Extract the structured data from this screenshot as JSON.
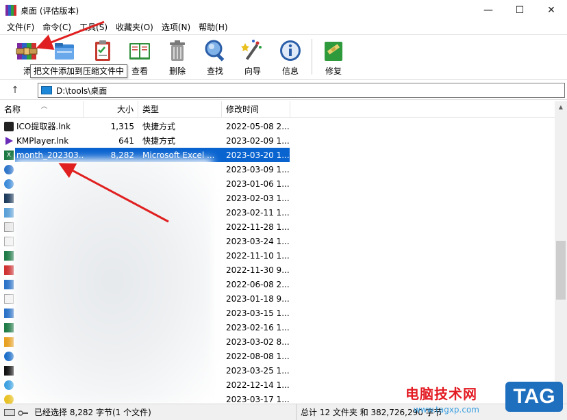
{
  "window": {
    "title": "桌面 (评估版本)",
    "minimize": "—",
    "maximize": "☐",
    "close": "✕"
  },
  "menu": [
    "文件(F)",
    "命令(C)",
    "工具(S)",
    "收藏夹(O)",
    "选项(N)",
    "帮助(H)"
  ],
  "toolbar": {
    "add": "添",
    "view": "查看",
    "delete": "删除",
    "find": "查找",
    "wizard": "向导",
    "info": "信息",
    "repair": "修复"
  },
  "tooltip": "把文件添加到压缩文件中",
  "address": {
    "path": "D:\\tools\\桌面",
    "up": "↑"
  },
  "columns": {
    "name": "名称",
    "size": "大小",
    "type": "类型",
    "modified": "修改时间"
  },
  "files": [
    {
      "name": "ICO提取器.lnk",
      "size": "1,315",
      "type": "快捷方式",
      "modified": "2022-05-08 2..."
    },
    {
      "name": "KMPlayer.lnk",
      "size": "641",
      "type": "快捷方式",
      "modified": "2023-02-09 1..."
    },
    {
      "name": "month_202303...",
      "size": "8,282",
      "type": "Microsoft Excel ...",
      "modified": "2023-03-20 1..."
    },
    {
      "name": "",
      "size": "",
      "type": "",
      "modified": "2023-03-09 1..."
    },
    {
      "name": "",
      "size": "",
      "type": "",
      "modified": "2023-01-06 1..."
    },
    {
      "name": "",
      "size": "",
      "type": "",
      "modified": "2023-02-03 1..."
    },
    {
      "name": "",
      "size": "",
      "type": "",
      "modified": "2023-02-11 1..."
    },
    {
      "name": "",
      "size": "",
      "type": "",
      "modified": "2022-11-28 1..."
    },
    {
      "name": "",
      "size": "",
      "type": "",
      "modified": "2023-03-24 1..."
    },
    {
      "name": "",
      "size": "",
      "type": "",
      "modified": "2022-11-10 1..."
    },
    {
      "name": "",
      "size": "",
      "type": "",
      "modified": "2022-11-30 9..."
    },
    {
      "name": "",
      "size": "",
      "type": "",
      "modified": "2022-06-08 2..."
    },
    {
      "name": "",
      "size": "",
      "type": "",
      "modified": "2023-01-18 9..."
    },
    {
      "name": "",
      "size": "",
      "type": "",
      "modified": "2023-03-15 1..."
    },
    {
      "name": "",
      "size": "",
      "type": "",
      "modified": "2023-02-16 1..."
    },
    {
      "name": "",
      "size": "",
      "type": "",
      "modified": "2023-03-02 8..."
    },
    {
      "name": "",
      "size": "",
      "type": "",
      "modified": "2022-08-08 1..."
    },
    {
      "name": "",
      "size": "",
      "type": "",
      "modified": "2023-03-25 1..."
    },
    {
      "name": "",
      "size": "",
      "type": "",
      "modified": "2022-12-14 1..."
    },
    {
      "name": "",
      "size": "",
      "type": "",
      "modified": "2023-03-17 1..."
    }
  ],
  "status": {
    "left": "已经选择 8,282 字节(1 个文件)",
    "right": "总计 12 文件夹 和 382,726,290 字节"
  },
  "watermark": {
    "text": "电脑技术网",
    "url": "www.tagxp.com",
    "tag": "TAG"
  },
  "colors": {
    "selection": "#0a64d0",
    "annotation_arrow": "#e02020",
    "watermark_red": "#e31b23",
    "watermark_blue": "#1f6fbf"
  }
}
